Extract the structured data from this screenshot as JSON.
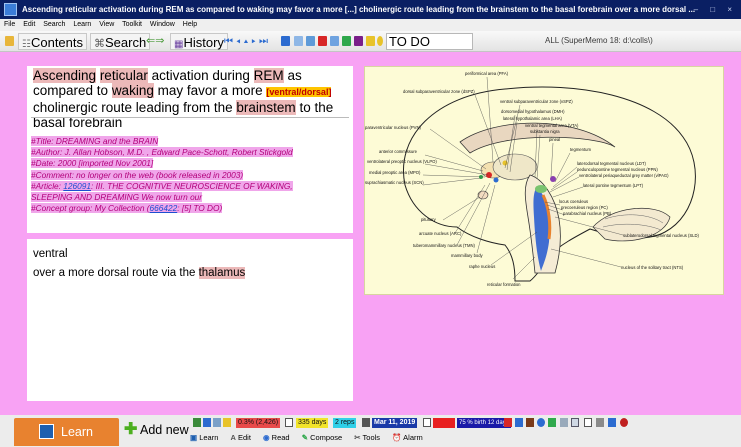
{
  "window": {
    "title": "Ascending reticular activation during REM as compared to waking may favor a more [...] cholinergic route leading from the brainstem to the basal forebrain over a more dorsal ...",
    "controls": "– □ ×"
  },
  "menu": [
    "File",
    "Edit",
    "Search",
    "Learn",
    "View",
    "Toolkit",
    "Window",
    "Help"
  ],
  "toolbar": {
    "contents_label": "Contents",
    "search_label": "Search",
    "history_label": "History",
    "concept_value": "TO DO",
    "collection": "ALL (SuperMemo 18: d:\\colls\\)",
    "colors": {
      "red": "#d72626",
      "blue": "#2c6bd0",
      "green": "#2fa84c",
      "yellow": "#e8c32a"
    }
  },
  "question": {
    "p1": "Ascending",
    "p2": "reticular",
    "p3": "activation during",
    "p4": "REM",
    "p5": "as compared to",
    "p6": "waking",
    "p7": "may favor a more",
    "cloze": "[ventral/dorsal]",
    "p8": "cholinergic route leading from the",
    "p9": "brainstem",
    "p10": "to the basal forebrain"
  },
  "references": {
    "title": "#Title: DREAMING and the BRAIN",
    "author": "#Author: J. Allan Hobson, M.D. , Edward Pace-Schott, Robert Stickgold",
    "date": "#Date: 2000 [imported Nov 2001]",
    "comment": "#Comment: no longer on the web (book released in 2003)",
    "article_prefix": "#Article:",
    "article_link": "126091",
    "article_text": ": III. THE COGNITIVE NEUROSCIENCE OF WAKING, SLEEPING AND DREAMING We now turn our",
    "concept_prefix": "#Concept group: My Collection (",
    "concept_link": "666422",
    "concept_suffix": ": [5] TO DO)"
  },
  "answer": {
    "line1": "ventral",
    "line2_prefix": "over a more dorsal route via the",
    "line2_highlight": "thalamus"
  },
  "brain_labels": {
    "l1": "periformical area (PFA)",
    "l2": "dorsal subparaventricular zone (dSPZ)",
    "l3": "ventral subparaventricular zone (vSPZ)",
    "l4": "dorsomedial hypothalamus (DMH)",
    "l5": "lateral hypothalamic area (LHA)",
    "l6": "ventral tegmental area (VTA)",
    "l7": "substantia nigra",
    "l8": "pineal",
    "l9": "paraventricular nucleus (PVN)",
    "l10": "tegmentum",
    "l11": "anterior commissure",
    "l12": "laterodorsal tegmental nucleus (LDT)",
    "l13": "pedunculopontine tegmental nucleus (PPN)",
    "l14": "ventrolateral preoptic nucleus (VLPO)",
    "l15": "ventrolateral periaqueductal grey matter (vlPAG)",
    "l16": "medial preoptic area (MPO)",
    "l17": "lateral pontine tegmentum (LPT)",
    "l18": "suprachiasmatic nucleus (SCN)",
    "l19": "locus coeruleus",
    "l20": "precoeruleus region (PC)",
    "l21": "parabrachial nucleus (PB)",
    "l22": "pituitary",
    "l23": "arcuate nucleus (ARC)",
    "l24": "tuberomammillary nucleus (TMN)",
    "l25": "mammillary body",
    "l26": "raphe nucleus",
    "l27": "reticular formation",
    "l28": "sublaterodorsal tegmental nucleus (SLD)",
    "l29": "nucleus of the solitary tract (NTS)"
  },
  "statusbar": {
    "learn_label": "Learn",
    "addnew_label": "Add new",
    "forgetting": "0.3% (2,426)",
    "interval": "335 days",
    "reps": "2 reps",
    "date": "Mar 11, 2019",
    "red_chip": "...",
    "priority": "75 % birth 12 days",
    "tabs": [
      "Learn",
      "Edit",
      "Read",
      "Compose",
      "Tools",
      "Alarm"
    ]
  }
}
